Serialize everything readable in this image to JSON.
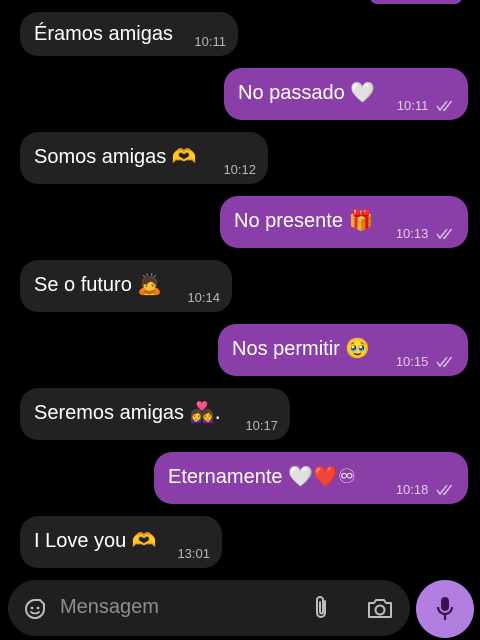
{
  "messages": [
    {
      "text": "Éramos amigas",
      "emoji": "",
      "time": "10:11",
      "direction": "in"
    },
    {
      "text": "No passado",
      "emoji": "🤍",
      "time": "10:11",
      "direction": "out",
      "status": "read"
    },
    {
      "text": "Somos amigas",
      "emoji": "🫶",
      "time": "10:12",
      "direction": "in"
    },
    {
      "text": "No presente",
      "emoji": "🎁",
      "time": "10:13",
      "direction": "out",
      "status": "read"
    },
    {
      "text": "Se o futuro",
      "emoji": "🙇",
      "time": "10:14",
      "direction": "in"
    },
    {
      "text": "Nos permitir",
      "emoji": "🥹",
      "time": "10:15",
      "direction": "out",
      "status": "read"
    },
    {
      "text": "Seremos amigas",
      "emoji": "👩‍❤️‍👩.",
      "time": "10:17",
      "direction": "in"
    },
    {
      "text": "Eternamente",
      "emoji": "🤍❤️♾",
      "time": "10:18",
      "direction": "out",
      "status": "read"
    },
    {
      "text": "I Love you",
      "emoji": "🫶",
      "time": "13:01",
      "direction": "in"
    }
  ],
  "composer": {
    "placeholder": "Mensagem",
    "icons": [
      "sticker-icon",
      "attach-icon",
      "camera-icon",
      "mic-icon"
    ]
  },
  "colors": {
    "background": "#000000",
    "incoming_bubble": "#222222",
    "outgoing_bubble": "#8a3fa8",
    "mic_button": "#b27ee0"
  }
}
